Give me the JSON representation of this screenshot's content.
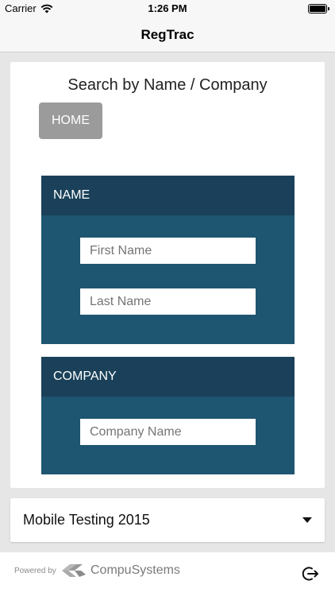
{
  "status_bar": {
    "carrier": "Carrier",
    "time": "1:26 PM"
  },
  "nav": {
    "title": "RegTrac"
  },
  "search": {
    "title": "Search by Name / Company",
    "home_label": "HOME",
    "name_panel": {
      "header": "NAME",
      "first_placeholder": "First Name",
      "last_placeholder": "Last Name"
    },
    "company_panel": {
      "header": "COMPANY",
      "company_placeholder": "Company Name"
    }
  },
  "event_select": {
    "selected": "Mobile Testing 2015"
  },
  "footer": {
    "powered_by": "Powered by",
    "brand": "CompuSystems"
  },
  "colors": {
    "panel_body": "#1e5571",
    "panel_header": "#1a4159",
    "home_button": "#9b9b9b"
  }
}
